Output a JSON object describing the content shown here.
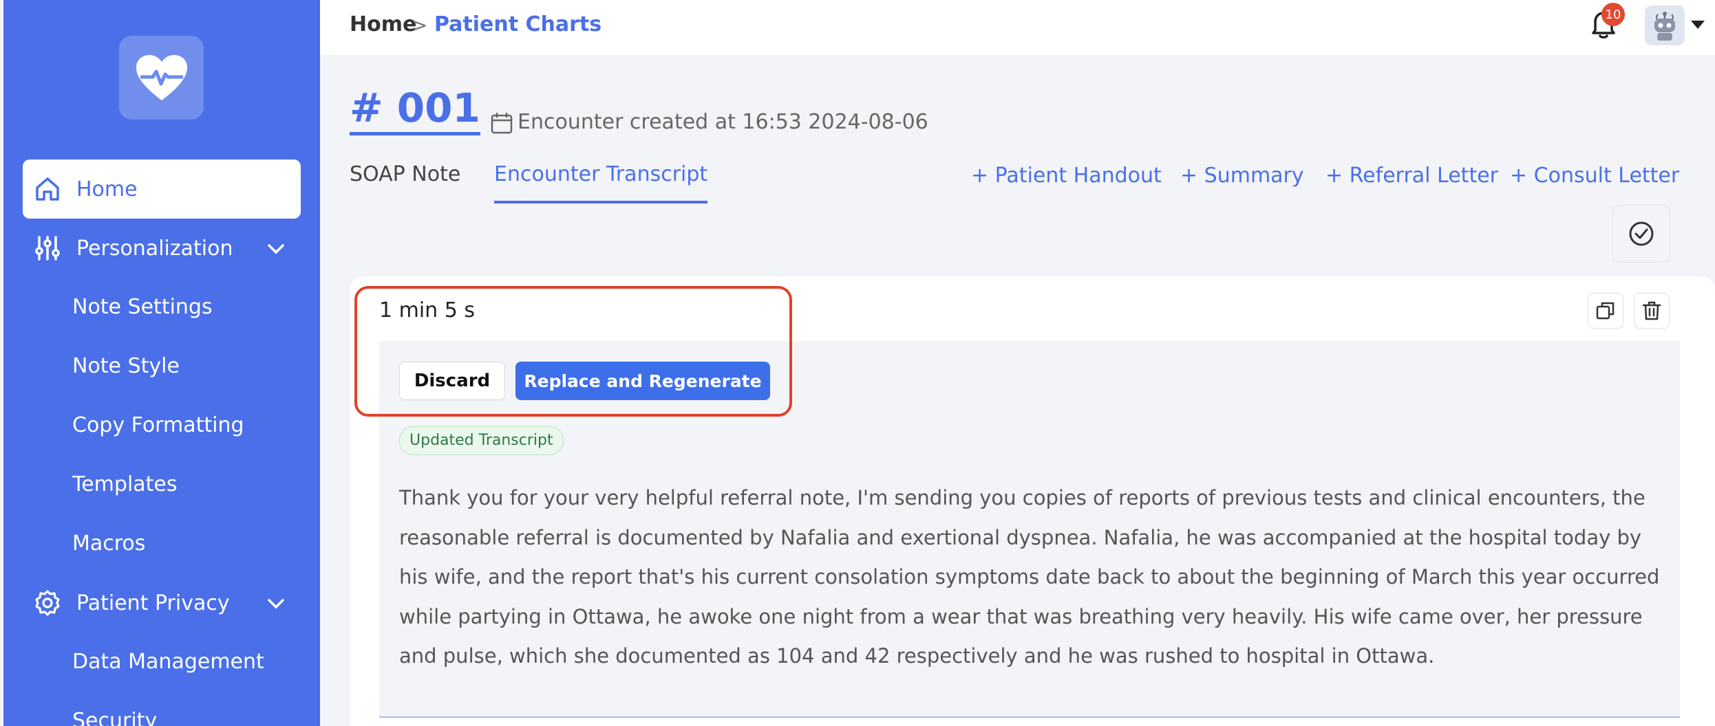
{
  "breadcrumb": {
    "home": "Home",
    "separator": ">",
    "current": "Patient Charts"
  },
  "notifications": {
    "count": "10"
  },
  "sidebar": {
    "items": [
      {
        "label": "Home"
      },
      {
        "label": "Personalization"
      },
      {
        "label": "Note Settings"
      },
      {
        "label": "Note Style"
      },
      {
        "label": "Copy Formatting"
      },
      {
        "label": "Templates"
      },
      {
        "label": "Macros"
      },
      {
        "label": "Patient Privacy"
      },
      {
        "label": "Data Management"
      },
      {
        "label": "Security"
      }
    ]
  },
  "encounter": {
    "id": "# 001",
    "created": "Encounter created at 16:53 2024-08-06"
  },
  "tabs": [
    {
      "label": "SOAP Note"
    },
    {
      "label": "Encounter Transcript"
    }
  ],
  "actions": [
    {
      "label": "+ Patient Handout"
    },
    {
      "label": "+ Summary"
    },
    {
      "label": "+ Referral Letter"
    },
    {
      "label": "+ Consult Letter"
    }
  ],
  "recording": {
    "duration": "1 min 5 s",
    "discard_label": "Discard",
    "replace_label": "Replace and Regenerate",
    "tag": "Updated Transcript",
    "transcript": "Thank you for your very helpful referral note, I'm sending you copies of reports of previous tests and clinical encounters, the reasonable referral is documented by Nafalia and exertional dyspnea. Nafalia, he was accompanied at the hospital today by his wife, and the report that's his current consolation symptoms date back to about the beginning of March this year occurred while partying in Ottawa, he awoke one night from a wear that was breathing very heavily. His wife came over, her pressure and pulse, which she documented as 104 and 42 respectively and he was rushed to hospital in Ottawa."
  },
  "colors": {
    "accent": "#4a6fe8",
    "highlight": "#e0432b",
    "badge": "#e04a2f"
  }
}
